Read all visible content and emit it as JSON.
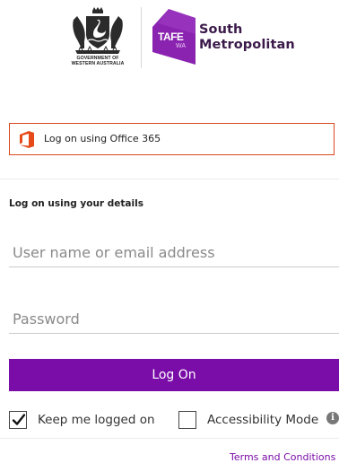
{
  "header": {
    "government_line1": "GOVERNMENT OF",
    "government_line2": "WESTERN AUSTRALIA",
    "tafe_badge_word": "TAFE",
    "tafe_badge_sub": "WA",
    "brand_line1": "South",
    "brand_line2": "Metropolitan",
    "crest_icon": "wa-government-crest-icon",
    "badge_icon": "tafe-wa-badge-icon"
  },
  "sso": {
    "label": "Log on using Office 365",
    "icon": "office-365-icon",
    "border_color": "#d8481e"
  },
  "login": {
    "heading": "Log on using your details",
    "username_placeholder": "User name or email address",
    "username_value": "",
    "password_placeholder": "Password",
    "password_value": "",
    "submit_label": "Log On",
    "submit_color": "#7a0da8"
  },
  "options": {
    "keep_logged_on_label": "Keep me logged on",
    "keep_logged_on_checked": true,
    "accessibility_label": "Accessibility Mode",
    "accessibility_checked": false,
    "info_icon": "info-icon"
  },
  "footer": {
    "terms_label": "Terms and Conditions",
    "link_color": "#7a0da8"
  }
}
